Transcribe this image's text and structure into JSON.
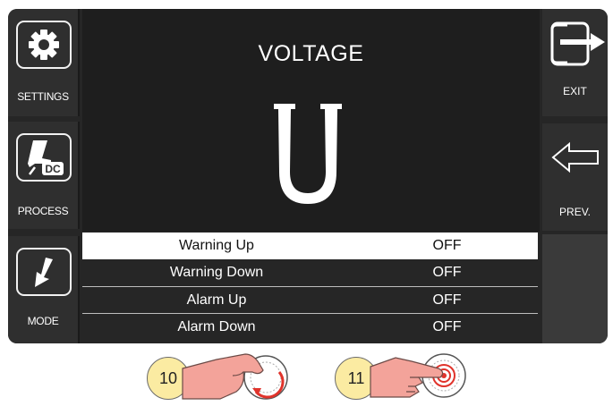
{
  "left_buttons": [
    {
      "label": "SETTINGS",
      "icon": "gear-icon"
    },
    {
      "label": "PROCESS",
      "icon": "welding-torch-dc-icon",
      "icon_text": "DC"
    },
    {
      "label": "MODE",
      "icon": "arrow-down-left-icon"
    }
  ],
  "right_buttons": [
    {
      "label": "EXIT",
      "icon": "exit-arrow-icon"
    },
    {
      "label": "PREV.",
      "icon": "back-arrow-icon"
    }
  ],
  "main": {
    "title": "VOLTAGE",
    "symbol": "U"
  },
  "rows": [
    {
      "name": "Warning Up",
      "value": "OFF",
      "selected": true
    },
    {
      "name": "Warning Down",
      "value": "OFF",
      "selected": false
    },
    {
      "name": "Alarm Up",
      "value": "OFF",
      "selected": false
    },
    {
      "name": "Alarm Down",
      "value": "OFF",
      "selected": false
    }
  ],
  "knobs": [
    {
      "number": "10",
      "action": "rotate-knob-icon"
    },
    {
      "number": "11",
      "action": "press-knob-icon"
    }
  ],
  "colors": {
    "screen_bg": "#262626",
    "button_bg": "#2f2f2f",
    "selected_row_bg": "#ffffff",
    "badge_bg": "#fbeba2",
    "hand": "#f3a39a",
    "rotate_arrow": "#e0332b"
  }
}
